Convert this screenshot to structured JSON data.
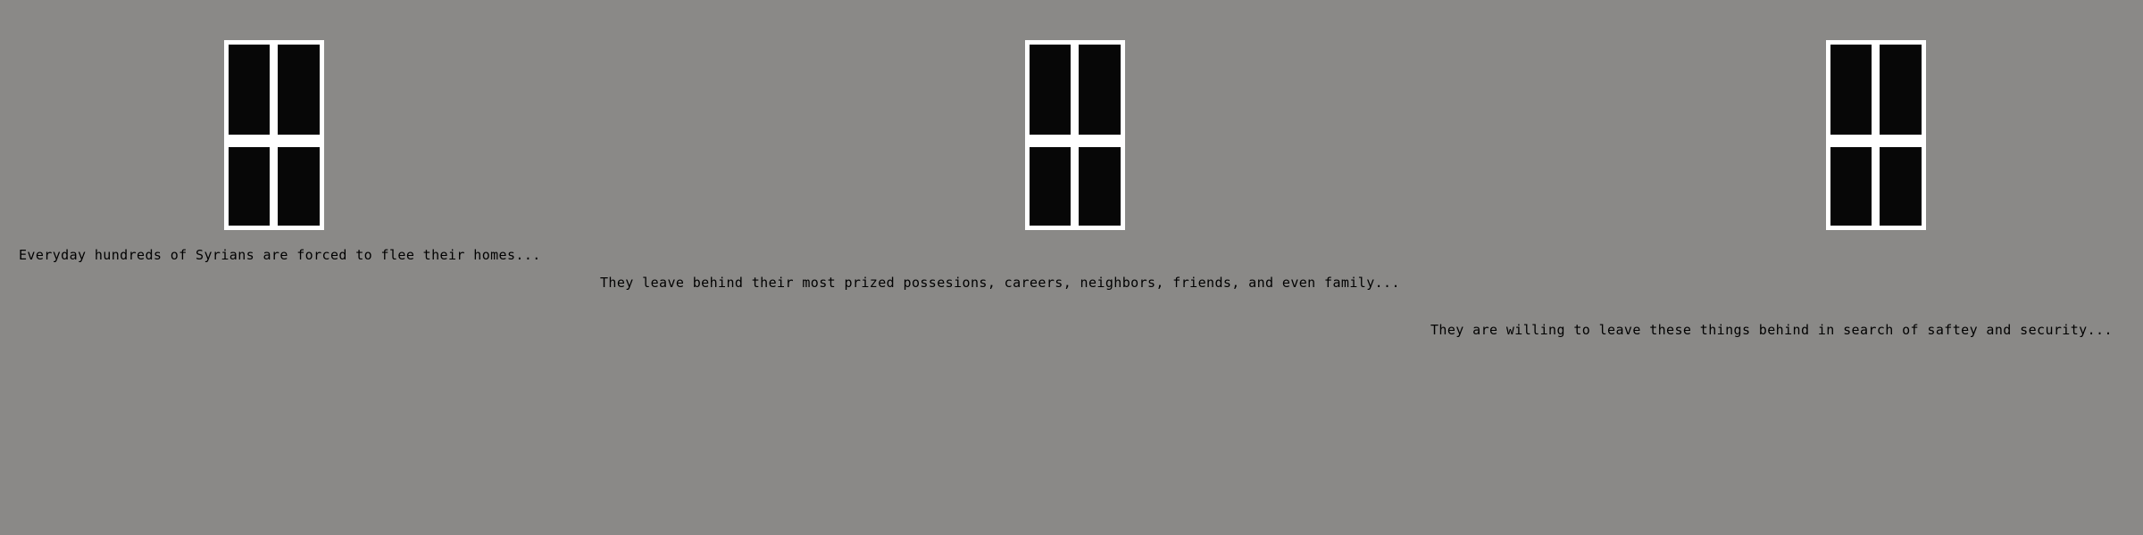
{
  "scene": {
    "background_color": "#8a8987",
    "window_frame_color": "#ffffff",
    "window_pane_color": "#070707",
    "windows": [
      {
        "icon": "window-icon"
      },
      {
        "icon": "window-icon"
      },
      {
        "icon": "window-icon"
      }
    ],
    "captions": [
      "Everyday hundreds of Syrians are forced to flee their homes...",
      "They leave behind their most prized possesions, careers, neighbors, friends, and even family...",
      "They are willing to leave these things behind in search of saftey and security..."
    ]
  }
}
